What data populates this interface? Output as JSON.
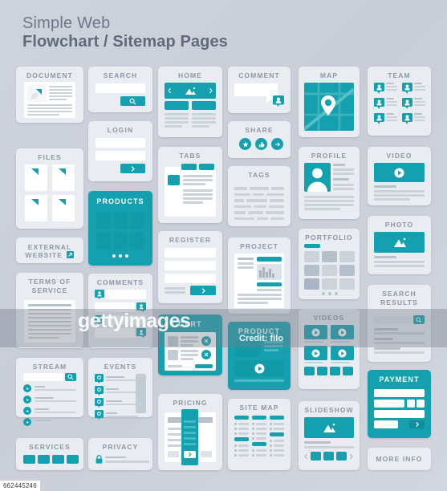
{
  "header": {
    "line1": "Simple Web",
    "line2": "Flowchart / Sitemap Pages"
  },
  "colors": {
    "teal": "#14a0ae",
    "card_bg": "#e9ecf1",
    "page_bg": "#ced3dc",
    "label": "#8d97a6",
    "title": "#5f6b7d"
  },
  "cards": {
    "document": "DOCUMENT",
    "files": "FILES",
    "external_website": "EXTERNAL WEBSITE",
    "terms_of_service": "TERMS OF SERVICE",
    "stream": "STREAM",
    "services": "SERVICES",
    "search": "SEARCH",
    "login": "LOGIN",
    "products": "PRODUCTS",
    "comments": "COMMENTS",
    "events": "EVENTS",
    "privacy": "PRIVACY",
    "home": "HOME",
    "tabs": "TABS",
    "register": "REGISTER",
    "cart": "CART",
    "pricing": "PRICING",
    "comment": "COMMENT",
    "share": "SHARE",
    "tags": "TAGS",
    "project": "PROJECT",
    "product": "PRODUCT",
    "site_map": "SITE MAP",
    "map": "MAP",
    "profile": "PROFILE",
    "portfolio": "PORTFOLIO",
    "videos": "VIDEOS",
    "slideshow": "SLIDESHOW",
    "team": "TEAM",
    "video": "VIDEO",
    "photo": "PHOTO",
    "search_results": "SEARCH RESULTS",
    "payment": "PAYMENT",
    "more_info": "MORE INFO"
  },
  "watermark": {
    "brand": "gettyimages",
    "credit": "Credit: filo",
    "asset_id": "662445246"
  }
}
